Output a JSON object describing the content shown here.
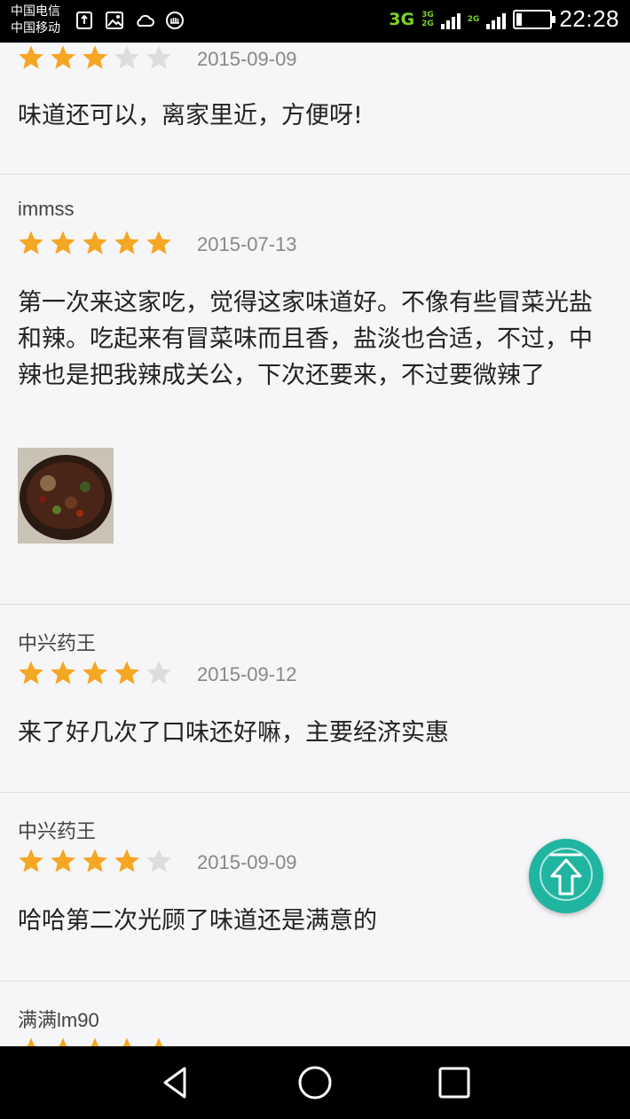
{
  "status_bar": {
    "carrier_1": "中国电信",
    "carrier_2": "中国移动",
    "network_1": "3G",
    "network_2a": "3G",
    "network_2b": "2G",
    "network_3": "2G",
    "time": "22:28",
    "icons": [
      "usb-icon",
      "image-icon",
      "weather-icon",
      "notification-icon",
      "signal-icon",
      "battery-icon"
    ],
    "battery_level": 0.15
  },
  "reviews": [
    {
      "username": "",
      "rating": 3,
      "date": "2015-09-09",
      "text": "味道还可以，离家里近，方便呀!",
      "has_photo": false
    },
    {
      "username": "immss",
      "rating": 5,
      "date": "2015-07-13",
      "text": "第一次来这家吃，觉得这家味道好。不像有些冒菜光盐和辣。吃起来有冒菜味而且香，盐淡也合适，不过，中辣也是把我辣成关公，下次还要来，不过要微辣了",
      "has_photo": true
    },
    {
      "username": "中兴药王",
      "rating": 4,
      "date": "2015-09-12",
      "text": "来了好几次了口味还好嘛，主要经济实惠",
      "has_photo": false
    },
    {
      "username": "中兴药王",
      "rating": 4,
      "date": "2015-09-09",
      "text": "哈哈第二次光顾了味道还是满意的",
      "has_photo": false
    },
    {
      "username": "满满lm90",
      "rating": 5,
      "date": "",
      "text": "",
      "has_photo": false
    }
  ],
  "colors": {
    "star_filled": "#f5a623",
    "star_empty": "#dddddd",
    "fab": "#1fb5a0",
    "accent_network": "#7ed321"
  },
  "fab": {
    "icon": "back-to-top-icon"
  },
  "nav_bar": {
    "buttons": [
      "back-icon",
      "home-icon",
      "recents-icon"
    ]
  }
}
